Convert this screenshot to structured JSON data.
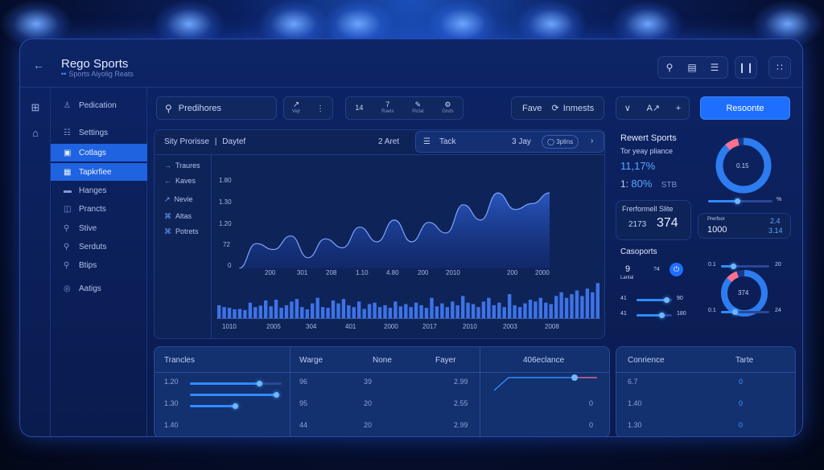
{
  "header": {
    "title": "Rego Sports",
    "subtitle": "Sports Aiyolig Reats",
    "icons": [
      "search-icon",
      "library-icon",
      "menu-icon",
      "pause-icon",
      "grid-icon"
    ]
  },
  "nav": {
    "items": [
      {
        "icon": "person-icon",
        "label": "Pedication"
      },
      {
        "icon": "settings-icon",
        "label": "Settings"
      },
      {
        "icon": "badge-icon",
        "label": "Cotlags"
      },
      {
        "icon": "table-icon",
        "label": "Tapkrfiee"
      },
      {
        "icon": "list-icon",
        "label": "Hanges"
      },
      {
        "icon": "page-icon",
        "label": "Prancts"
      },
      {
        "icon": "pin-icon",
        "label": "Stive"
      },
      {
        "icon": "pin-icon",
        "label": "Serduts"
      },
      {
        "icon": "pin-icon",
        "label": "Btips"
      },
      {
        "icon": "circle-icon",
        "label": "Aatigs"
      }
    ]
  },
  "toolbar": {
    "search_value": "Predihores",
    "small_group1": [
      {
        "top": "↗",
        "bottom": "Vejr"
      },
      {
        "top": "⋮",
        "bottom": ""
      }
    ],
    "small_group2": [
      {
        "top": "14",
        "bottom": ""
      },
      {
        "top": "7",
        "bottom": "Raels"
      },
      {
        "top": "✎",
        "bottom": "Piclal"
      },
      {
        "top": "⚙",
        "bottom": "Gnds"
      }
    ],
    "fave_label": "Fave",
    "inmests_label": "Inmests",
    "chev_label": "∨",
    "ai_label": "A↗",
    "plus_label": "+",
    "primary_button": "Resoonte"
  },
  "chart_panel": {
    "left_title": "Sity Prorisse",
    "left_sep": "|",
    "left_sub": "Daytef",
    "left_right": "2 Aret",
    "track_label": "Tack",
    "track_date": "3 Jay",
    "track_badge": "3plins",
    "legend": [
      {
        "icon": "→",
        "label": "Traures"
      },
      {
        "icon": "←",
        "label": "Kaves"
      },
      {
        "icon": "↗",
        "label": "Nevie"
      },
      {
        "icon": "⌘",
        "label": "Altas"
      },
      {
        "icon": "⌘",
        "label": "Potrets"
      }
    ]
  },
  "chart_data": {
    "type": "area",
    "title": "",
    "xlabel": "",
    "ylabel": "",
    "y_ticks": [
      "1.80",
      "1.30",
      "1.20",
      "72",
      "0"
    ],
    "x_ticks": [
      "200",
      "301",
      "208",
      "1.10",
      "4.80",
      "200",
      "2010",
      "200",
      "2000"
    ],
    "ylim": [
      0,
      180
    ],
    "series": [
      {
        "values": [
          0,
          42,
          32,
          55,
          18,
          50,
          35,
          70,
          45,
          82,
          45,
          78,
          60,
          108,
          82,
          128,
          100,
          110,
          128
        ]
      }
    ],
    "bars": [
      35,
      30,
      28,
      24,
      25,
      22,
      42,
      30,
      34,
      48,
      32,
      50,
      28,
      35,
      45,
      52,
      30,
      24,
      40,
      55,
      30,
      28,
      48,
      40,
      52,
      35,
      30,
      45,
      25,
      38,
      42,
      30,
      35,
      28,
      45,
      32,
      38,
      30,
      42,
      35,
      28,
      55,
      32,
      40,
      30,
      45,
      35,
      60,
      42,
      38,
      30,
      45,
      55,
      35,
      42,
      30,
      65,
      35,
      30,
      40,
      50,
      45,
      55,
      42,
      38,
      60,
      70,
      55,
      65,
      75,
      60,
      80,
      70,
      95
    ],
    "bar_x_ticks": [
      "1010",
      "2005",
      "304",
      "401",
      "2000",
      "2017",
      "2010",
      "2003",
      "2008"
    ]
  },
  "stats": {
    "title": "Rewert Sports",
    "subtitle": "Tor yeay pliance",
    "percent1": "11,17%",
    "prefix2": "1:",
    "percent2": "80%",
    "suffix2": "STB",
    "box_title": "Frerformell Slite",
    "box_small": "2173",
    "box_big": "374",
    "cas_title": "Casoports",
    "cas_num": "9",
    "cas_sub": "Lantal",
    "cas_num2": "?4",
    "cas_badge": "⏻",
    "sliders": [
      {
        "left": "41",
        "right": "90",
        "fill": 0.85
      },
      {
        "left": "41",
        "right": "180",
        "fill": 0.7
      }
    ]
  },
  "donut1": {
    "center": "0.15",
    "fill": 0.9,
    "slider_fill": 0.45,
    "slider_right": "%"
  },
  "mid_stats": {
    "label1": "Prerfoor",
    "val1": "1000",
    "label2": "2.4",
    "val2": "3.14"
  },
  "donut2": {
    "center": "374",
    "fill": 0.88,
    "top_left": "0.1",
    "top_right": "20",
    "top_fill": 0.25,
    "bottom_left": "0.1",
    "bottom_right": "24",
    "bottom_fill": 0.28
  },
  "table1": {
    "headers": [
      "Trancles",
      "Warge",
      "None",
      "Fayer",
      "406eclance"
    ],
    "rows": [
      {
        "c1": "1.20",
        "c2": "96",
        "c3": "39",
        "c4": "2.99",
        "c5": "",
        "fill": 0.75
      },
      {
        "c1": "1.30",
        "c2": "95",
        "c3": "20",
        "c4": "2.55",
        "c5": "0",
        "fill": 0.58
      },
      {
        "c1": "1.40",
        "c2": "44",
        "c3": "20",
        "c4": "2.99",
        "c5": "0",
        "fill": 0.48
      }
    ]
  },
  "table2": {
    "headers": [
      "Conrience",
      "Tarte"
    ],
    "rows": [
      {
        "c1": "6.7",
        "c2": "0"
      },
      {
        "c1": "1.40",
        "c2": "0"
      },
      {
        "c1": "1.30",
        "c2": "0"
      }
    ]
  },
  "colors": {
    "accent": "#1f6fff",
    "highlight": "#2f8cff",
    "pink": "#ff6f8e"
  }
}
